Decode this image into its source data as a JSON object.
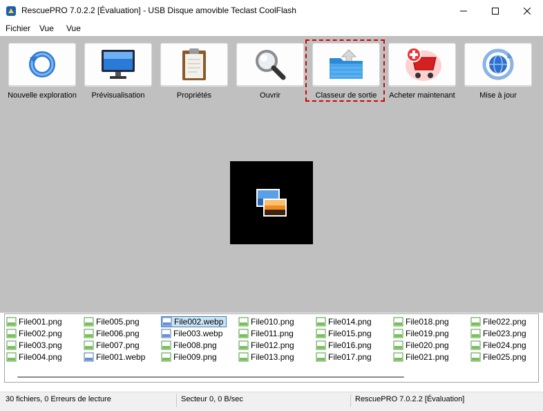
{
  "window": {
    "title": "RescuePRO 7.0.2.2 [Évaluation] - USB Disque amovible Teclast CoolFlash",
    "minimize_glyph": "—",
    "maximize_glyph": "☐",
    "close_glyph": "✕"
  },
  "menu": {
    "items": [
      "Fichier",
      "Vue",
      "Vue"
    ]
  },
  "menubar": {
    "fichier": "Fichier",
    "vue": "Vue"
  },
  "toolbar": {
    "items": [
      {
        "label": "Nouvelle exploration",
        "icon": "refresh-icon"
      },
      {
        "label": "Prévisualisation",
        "icon": "monitor-icon"
      },
      {
        "label": "Propriétés",
        "icon": "clipboard-icon"
      },
      {
        "label": "Ouvrir",
        "icon": "magnifier-icon"
      },
      {
        "label": "Classeur de sortie",
        "icon": "folder-upload-icon"
      },
      {
        "label": "Acheter maintenant",
        "icon": "shopping-cart-icon"
      },
      {
        "label": "Mise à jour",
        "icon": "globe-update-icon"
      }
    ]
  },
  "files": {
    "columns": [
      [
        "File001.png",
        "File002.png",
        "File003.png",
        "File004.png"
      ],
      [
        "File005.png",
        "File006.png",
        "File007.png",
        "File001.webp"
      ],
      [
        "File002.webp",
        "File003.webp",
        "File008.png",
        "File009.png"
      ],
      [
        "File010.png",
        "File011.png",
        "File012.png",
        "File013.png"
      ],
      [
        "File014.png",
        "File015.png",
        "File016.png",
        "File017.png"
      ],
      [
        "File018.png",
        "File019.png",
        "File020.png",
        "File021.png"
      ],
      [
        "File022.png",
        "File023.png",
        "File024.png",
        "File025.png"
      ]
    ],
    "selected": "File002.webp"
  },
  "status": {
    "files": "30 fichiers, 0 Erreurs de lecture",
    "sector": "Secteur 0, 0 B/sec",
    "version": "RescuePRO 7.0.2.2 [Évaluation]"
  },
  "colors": {
    "workspace": "#c0c0c0",
    "selection": "#cce4f7",
    "focus_outline": "#d40000"
  }
}
